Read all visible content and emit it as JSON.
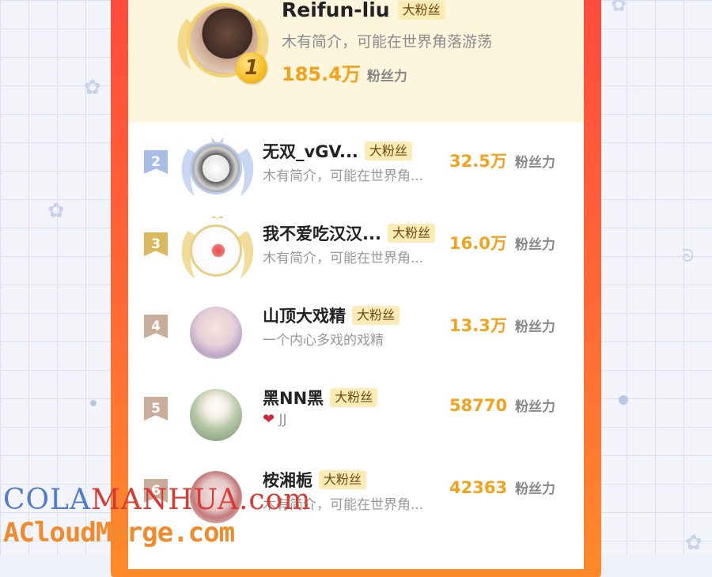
{
  "top_entry": {
    "rank": "1",
    "name": "Reifun-liu",
    "badge": "大粉丝",
    "bio": "木有简介，可能在世界角落游荡",
    "power_value": "185.4万",
    "power_unit": "粉丝力"
  },
  "entries": [
    {
      "rank": "2",
      "name": "无双_vGV...",
      "badge": "大粉丝",
      "bio": "木有简介，可能在世界角...",
      "power_value": "32.5万",
      "power_unit": "粉丝力"
    },
    {
      "rank": "3",
      "name": "我不爱吃汉汉...",
      "badge": "大粉丝",
      "bio": "木有简介，可能在世界角...",
      "power_value": "16.0万",
      "power_unit": "粉丝力"
    },
    {
      "rank": "4",
      "name": "山顶大戏精",
      "badge": "大粉丝",
      "bio": "一个内心多戏的戏精",
      "power_value": "13.3万",
      "power_unit": "粉丝力"
    },
    {
      "rank": "5",
      "name": "黑NN黑",
      "badge": "大粉丝",
      "bio": "JJ",
      "power_value": "58770",
      "power_unit": "粉丝力"
    },
    {
      "rank": "6",
      "name": "桉湘栀",
      "badge": "大粉丝",
      "bio": "木有简介，可能在世界角...",
      "power_value": "42363",
      "power_unit": "粉丝力"
    }
  ],
  "watermark": {
    "line1_blue": "COLA",
    "line1_red": "MANHUA",
    "line1_tail": ".com",
    "line2": "ACloudMerge.com"
  },
  "icons": {
    "heart": "heart-icon",
    "medal": "medal-icon",
    "wings": "wings-icon"
  },
  "colors": {
    "panel_accent": "#ff4a3d",
    "power_number": "#f3a21c",
    "badge_bg": "#fcebb2",
    "rank2_flag": "#a8bde6",
    "rank3_flag": "#d9b85e",
    "rank4_flag": "#c8ad9a",
    "rank5_flag": "#c8ad9a"
  }
}
